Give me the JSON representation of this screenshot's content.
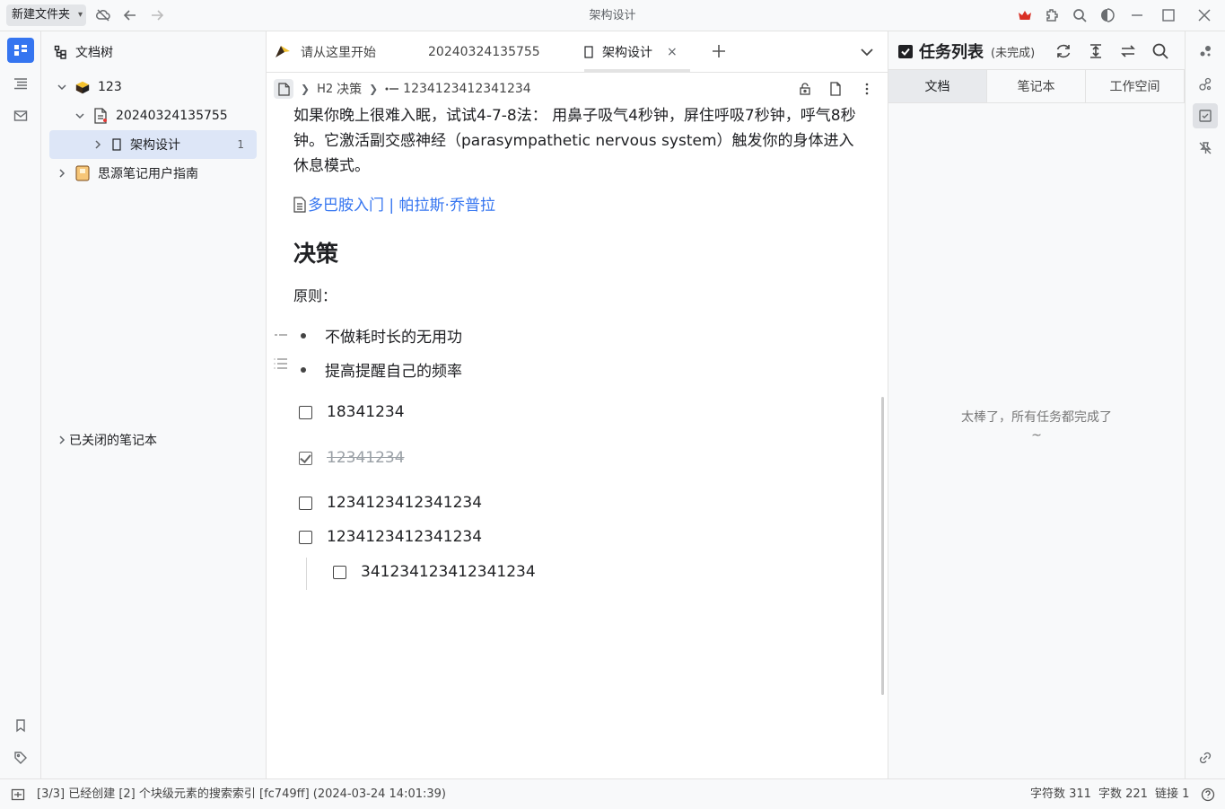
{
  "titlebar": {
    "workspace": "新建文件夹",
    "title": "架构设计"
  },
  "tree": {
    "heading": "文档树",
    "items": [
      {
        "label": "123"
      },
      {
        "label": "20240324135755"
      },
      {
        "label": "架构设计",
        "badge": "1"
      },
      {
        "label": "思源笔记用户指南"
      }
    ],
    "closed_notebooks": "已关闭的笔记本"
  },
  "tabs": [
    {
      "label": "请从这里开始"
    },
    {
      "label": "20240324135755"
    },
    {
      "label": "架构设计",
      "close": "×"
    }
  ],
  "breadcrumb": {
    "heading_tag": "H2",
    "heading": "决策",
    "item": "1234123412341234"
  },
  "doc": {
    "paragraph": "如果你晚上很难入眠，试试4-7-8法： 用鼻子吸气4秒钟，屏住呼吸7秒钟，呼气8秒钟。它激活副交感神经（parasympathetic nervous system）触发你的身体进入休息模式。",
    "link": "多巴胺入门 | 帕拉斯·乔普拉",
    "heading": "决策",
    "principle": "原则：",
    "bullets": [
      "不做耗时长的无用功",
      "提高提醒自己的频率"
    ],
    "tasks": [
      {
        "text": "18341234",
        "done": false
      },
      {
        "text": "12341234",
        "done": true
      },
      {
        "text": "1234123412341234",
        "done": false
      },
      {
        "text": "1234123412341234",
        "done": false
      },
      {
        "text": "341234123412341234",
        "done": false
      }
    ]
  },
  "tasks_panel": {
    "title": "任务列表",
    "filter": "(未完成)",
    "tabs": [
      "文档",
      "笔记本",
      "工作空间"
    ],
    "empty": "太棒了，所有任务都完成了~"
  },
  "status": {
    "message": "[3/3] 已经创建 [2] 个块级元素的搜索索引 [fc749ff] (2024-03-24 14:01:39)",
    "chars": "字符数 311",
    "words": "字数 221",
    "links": "链接 1"
  }
}
